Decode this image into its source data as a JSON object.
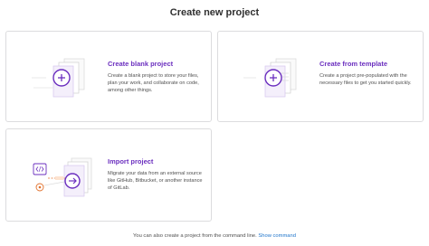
{
  "page": {
    "title": "Create new project"
  },
  "cards": [
    {
      "title": "Create blank project",
      "description": "Create a blank project to store your files, plan your work, and collaborate on code, among other things.",
      "icon": "plus-icon"
    },
    {
      "title": "Create from template",
      "description": "Create a project pre-populated with the necessary files to get you started quickly.",
      "icon": "plus-icon"
    },
    {
      "title": "Import project",
      "description": "Migrate your data from an external source like GitHub, Bitbucket, or another instance of GitLab.",
      "icon": "arrow-right-icon"
    }
  ],
  "footer": {
    "text": "You can also create a project from the command line.",
    "link": "Show command"
  },
  "colors": {
    "accent": "#6b2fbf",
    "link": "#1f75cb",
    "border": "#dcdcde",
    "import_orange": "#e2712c"
  }
}
